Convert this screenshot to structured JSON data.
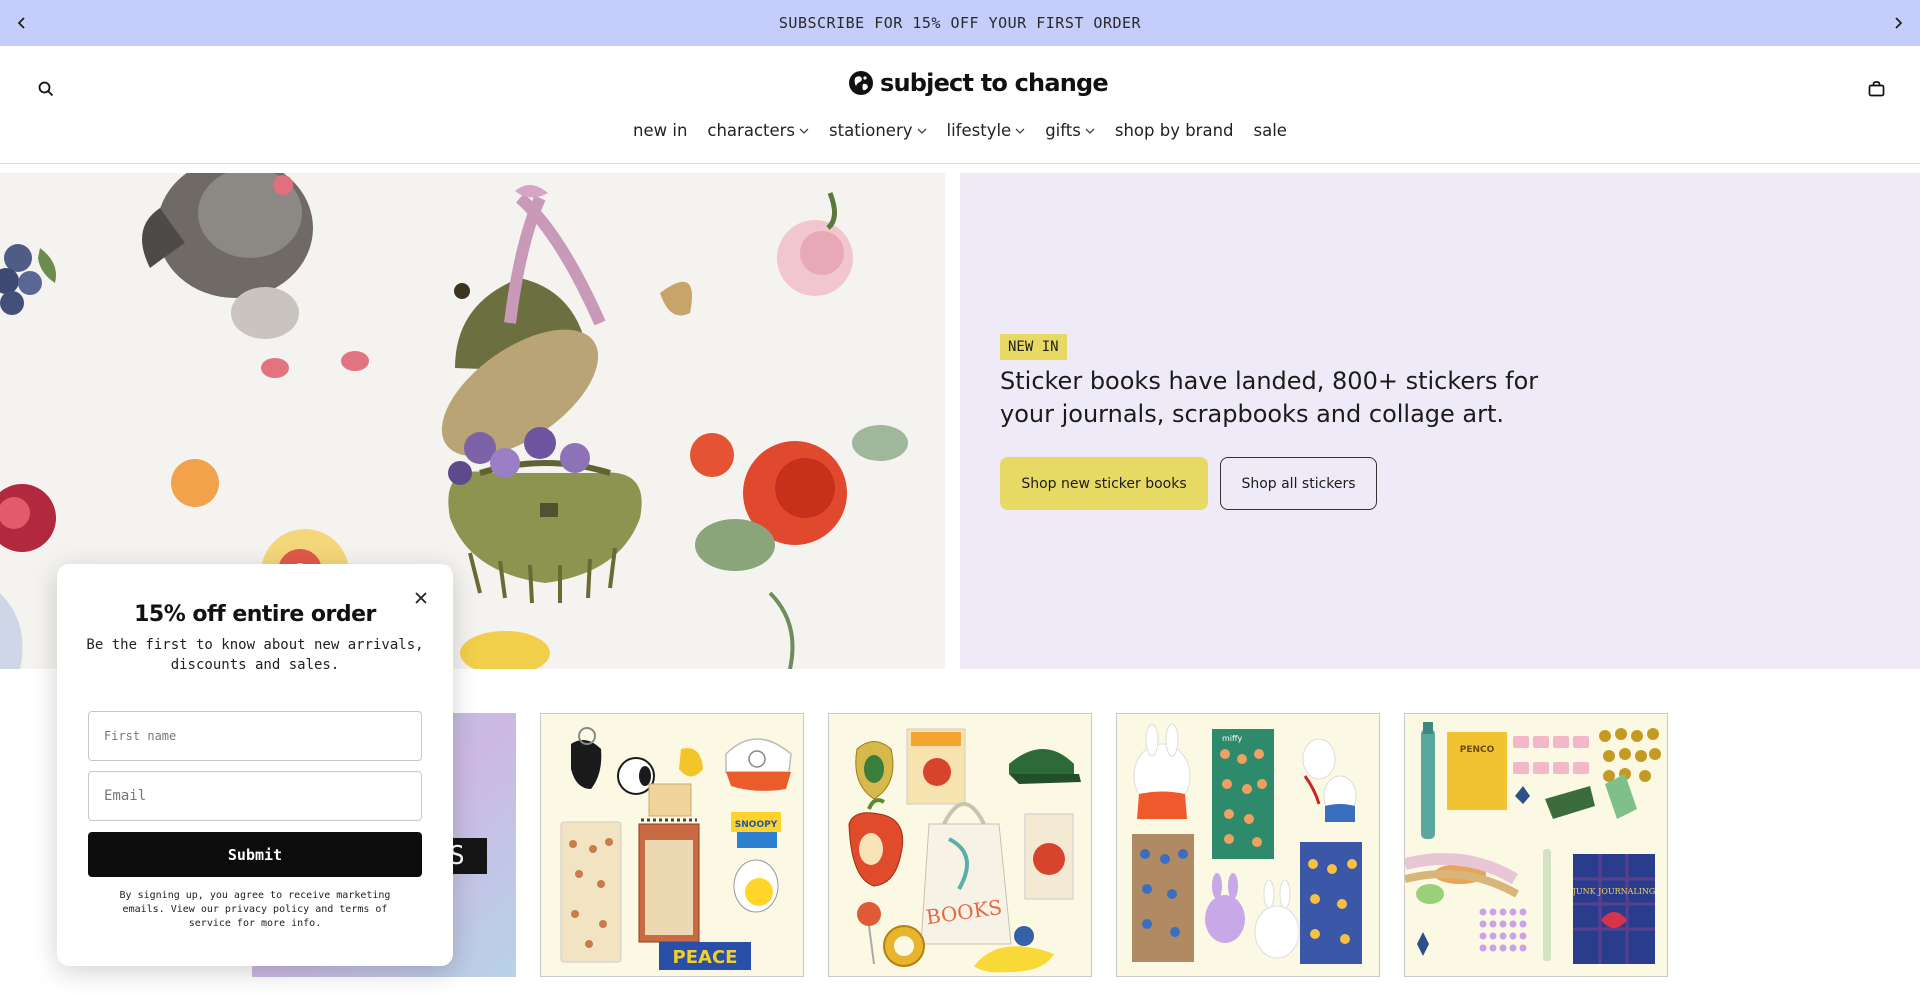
{
  "announcement": {
    "text": "SUBSCRIBE FOR 15% OFF YOUR FIRST ORDER"
  },
  "header": {
    "logo_text": "subject to change"
  },
  "nav": {
    "items": [
      {
        "label": "new in",
        "dropdown": false
      },
      {
        "label": "characters",
        "dropdown": true
      },
      {
        "label": "stationery",
        "dropdown": true
      },
      {
        "label": "lifestyle",
        "dropdown": true
      },
      {
        "label": "gifts",
        "dropdown": true
      },
      {
        "label": "shop by brand",
        "dropdown": false
      },
      {
        "label": "sale",
        "dropdown": false
      }
    ]
  },
  "hero": {
    "badge": "NEW IN",
    "title": "Sticker books have landed, 800+ stickers for your journals, scrapbooks and collage art.",
    "primary_button": "Shop new sticker books",
    "secondary_button": "Shop all stickers",
    "panel_color": "#efeaf7",
    "accent_color": "#e6d964"
  },
  "tiles": {
    "partial_label": "S",
    "items": [
      {
        "name": "snoopy-collection",
        "sign": "PEACE",
        "tag": "SNOOPY"
      },
      {
        "name": "books-collection",
        "sign": "BOOKS"
      },
      {
        "name": "miffy-collection",
        "tag": "miffy"
      },
      {
        "name": "penco-stationery",
        "tag": "PENCO",
        "book": "JUNK JOURNALING"
      }
    ]
  },
  "popup": {
    "title": "15% off entire order",
    "subtitle": "Be the first to know about new arrivals, discounts and sales.",
    "first_name_placeholder": "First name",
    "email_placeholder": "Email",
    "submit_label": "Submit",
    "legal": "By signing up, you agree to receive marketing emails. View our privacy policy and terms of service for more info."
  },
  "colors": {
    "announcement_bg": "#c5cdfa",
    "button_dark": "#0c0c0c"
  }
}
